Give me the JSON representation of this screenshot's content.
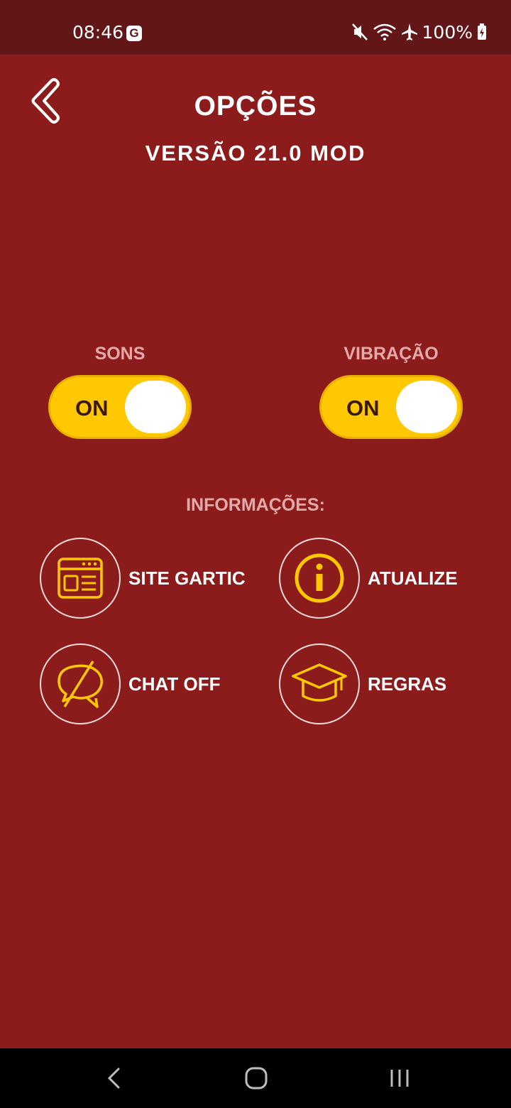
{
  "status_bar": {
    "time": "08:46",
    "google_badge": "G",
    "battery": "100%",
    "icons": [
      "mute-icon",
      "wifi-icon",
      "airplane-icon",
      "battery-charging-icon"
    ]
  },
  "header": {
    "back_icon": "chevron-left-icon",
    "title": "OPÇÕES",
    "version": "VERSÃO 21.0 MOD"
  },
  "toggles": [
    {
      "label": "SONS",
      "state": "ON"
    },
    {
      "label": "VIBRAÇÃO",
      "state": "ON"
    }
  ],
  "info": {
    "title": "INFORMAÇÕES:",
    "items": [
      {
        "label": "SITE GARTIC",
        "icon": "browser-window-icon"
      },
      {
        "label": "ATUALIZE",
        "icon": "info-icon"
      },
      {
        "label": "CHAT OFF",
        "icon": "chat-off-icon"
      },
      {
        "label": "REGRAS",
        "icon": "graduation-cap-icon"
      }
    ]
  },
  "nav_bar": {
    "buttons": [
      "back-nav-icon",
      "home-nav-icon",
      "recents-nav-icon"
    ]
  },
  "colors": {
    "background": "#8c1c1c",
    "status_bar": "#621618",
    "accent": "#ffc800",
    "muted_label": "#e5a9a9"
  }
}
